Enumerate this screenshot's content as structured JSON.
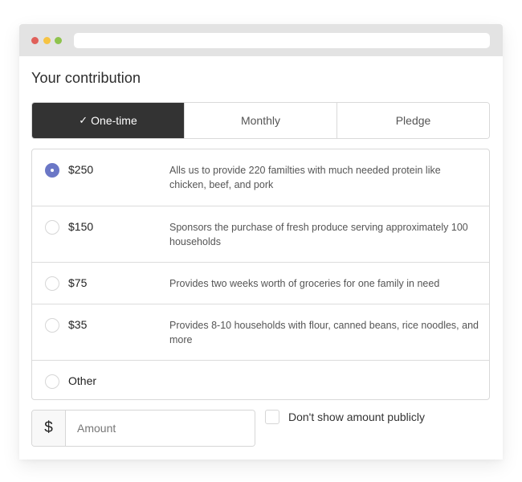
{
  "window": {
    "controls": [
      "close",
      "minimize",
      "maximize"
    ],
    "address_bar": ""
  },
  "form": {
    "title": "Your contribution",
    "frequency_tabs": [
      {
        "label": "One-time",
        "selected": true,
        "icon": "check-icon"
      },
      {
        "label": "Monthly",
        "selected": false
      },
      {
        "label": "Pledge",
        "selected": false
      }
    ],
    "check_glyph": "✓",
    "options": [
      {
        "amount": "$250",
        "description": "Alls us to provide 220 familties with much needed protein like chicken, beef, and pork",
        "selected": true
      },
      {
        "amount": "$150",
        "description": "Sponsors the purchase of fresh produce serving approximately 100 households",
        "selected": false
      },
      {
        "amount": "$75",
        "description": "Provides two weeks worth of groceries for one family in need",
        "selected": false
      },
      {
        "amount": "$35",
        "description": "Provides 8-10 households with flour, canned beans, rice noodles, and more",
        "selected": false
      },
      {
        "amount": "Other",
        "description": "",
        "selected": false
      }
    ],
    "amount_input": {
      "prefix": "$",
      "placeholder": "Amount",
      "value": ""
    },
    "hide_amount": {
      "label": "Don't show amount publicly",
      "checked": false
    }
  },
  "colors": {
    "active_tab": "#333333",
    "radio_selected": "#6b77c6",
    "titlebar": "#e3e3e3"
  }
}
